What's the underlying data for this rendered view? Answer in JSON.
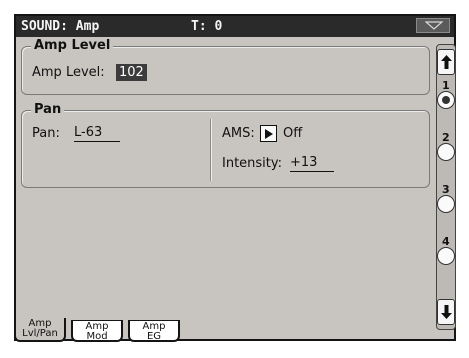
{
  "header": {
    "title": "SOUND: Amp",
    "tempo": "T: 0",
    "menu_icon": "triangle-down-icon"
  },
  "amp_level": {
    "legend": "Amp Level",
    "label": "Amp Level:",
    "value": "102"
  },
  "pan": {
    "legend": "Pan",
    "pan_label": "Pan:",
    "pan_value": "L-63",
    "ams_label": "AMS:",
    "ams_value": "Off",
    "intensity_label": "Intensity:",
    "intensity_value": "+13"
  },
  "pages": {
    "selected": "1",
    "items": [
      "1",
      "2",
      "3",
      "4"
    ]
  },
  "tabs": [
    {
      "line1": "Amp",
      "line2": "Lvl/Pan",
      "active": true
    },
    {
      "line1": "Amp",
      "line2": "Mod",
      "active": false
    },
    {
      "line1": "Amp",
      "line2": "EG",
      "active": false
    }
  ]
}
